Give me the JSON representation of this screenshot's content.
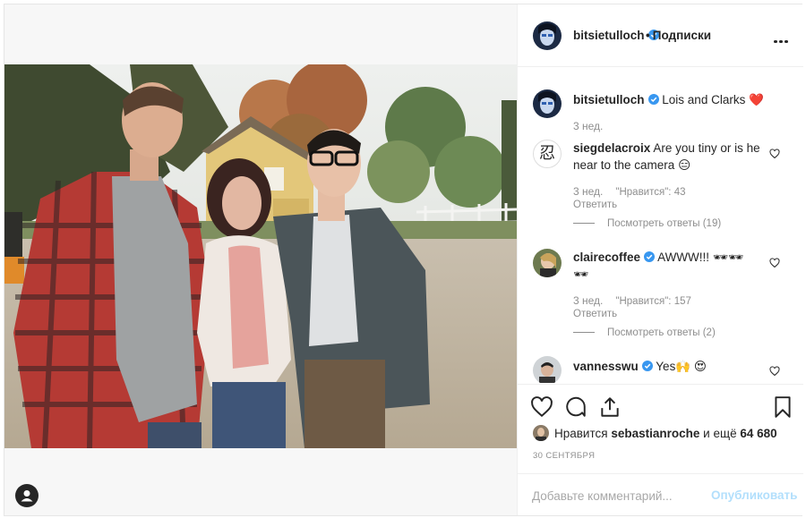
{
  "post": {
    "author": "bitsietulloch",
    "follow_label": "Подписки",
    "separator": "•",
    "date": "30 СЕНТЯБРЯ",
    "liked_by": "sebastianroche",
    "likes_prefix": "Нравится",
    "likes_and": "и ещё",
    "likes_count": "64 680",
    "add_comment_placeholder": "Добавьте комментарий...",
    "publish_label": "Опубликовать"
  },
  "caption": {
    "user": "bitsietulloch",
    "text": "Lois and Clarks",
    "emoji": "❤️",
    "time": "3 нед."
  },
  "comments": [
    {
      "user": "siegdelacroix",
      "text": "Are you tiny or is he near to the camera",
      "emoji": "😑",
      "time": "3 нед.",
      "likes": "\"Нравится\": 43",
      "reply": "Ответить",
      "view_replies": "Посмотреть ответы (19)",
      "avatar_glyph": "忍"
    },
    {
      "user": "clairecoffee",
      "text": "AWWW!!!",
      "emoji": "🕶🕶",
      "emoji2": "🕶",
      "time": "3 нед.",
      "likes": "\"Нравится\": 157",
      "reply": "Ответить",
      "view_replies": "Посмотреть ответы (2)"
    },
    {
      "user": "vannesswu",
      "text": "Yes",
      "emoji": "🙌 😍"
    }
  ],
  "icons": {
    "more": "more-options-icon",
    "like": "heart-icon",
    "comment": "comment-bubble-icon",
    "share": "share-icon",
    "save": "bookmark-icon",
    "tag": "user-tag-icon",
    "verified": "verified-badge-icon"
  },
  "colors": {
    "verified_blue": "#3897f0",
    "text": "#262626",
    "muted": "#8e8e8e",
    "publish_disabled": "#b2dffc",
    "heart_red": "#e0245e"
  }
}
